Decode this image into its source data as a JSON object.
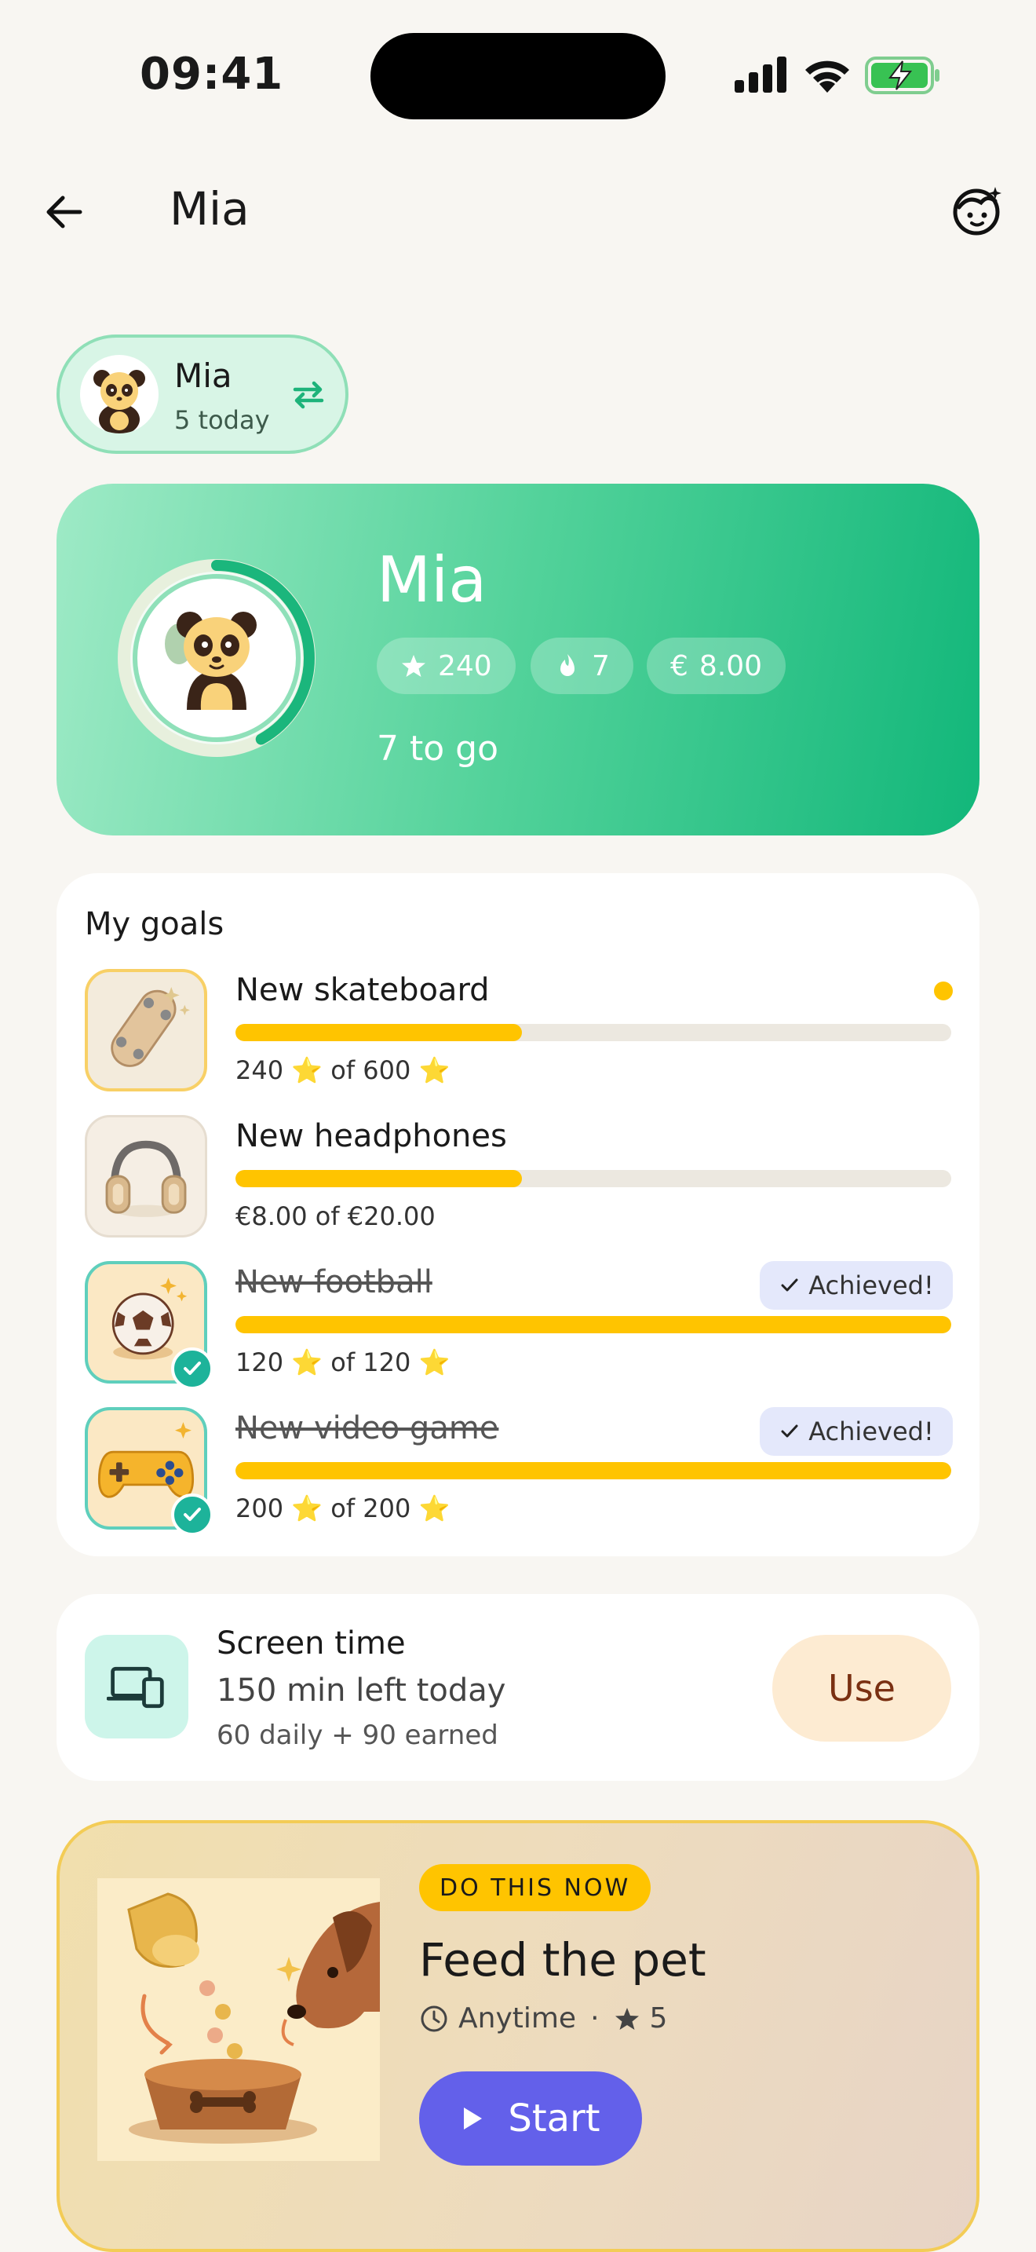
{
  "status_bar": {
    "time": "09:41"
  },
  "header": {
    "title": "Mia"
  },
  "profile_chip": {
    "name": "Mia",
    "subtitle": "5 today"
  },
  "hero": {
    "name": "Mia",
    "stars": "240",
    "streak": "7",
    "money": "8.00",
    "to_go": "7 to go",
    "ring_progress": 0.42,
    "colors": {
      "start": "#9eeac6",
      "end": "#12b77a"
    }
  },
  "goals": {
    "title": "My goals",
    "items": [
      {
        "name": "New skateboard",
        "progress": 0.4,
        "achieved": false,
        "current": "240",
        "of": "of 600",
        "unit": "star",
        "thumb": "skateboard-icon"
      },
      {
        "name": "New headphones",
        "progress": 0.4,
        "achieved": false,
        "text": "€8.00 of €20.00",
        "thumb": "headphones-icon"
      },
      {
        "name": "New football",
        "progress": 1.0,
        "achieved": true,
        "badge": "Achieved!",
        "current": "120",
        "of": "of 120",
        "unit": "star",
        "thumb": "football-icon"
      },
      {
        "name": "New video game",
        "progress": 1.0,
        "achieved": true,
        "badge": "Achieved!",
        "current": "200",
        "of": "of 200",
        "unit": "star",
        "thumb": "gamepad-icon"
      }
    ]
  },
  "screen_time": {
    "title": "Screen time",
    "left": "150 min left today",
    "detail": "60 daily + 90 earned",
    "button": "Use"
  },
  "task": {
    "tag": "DO THIS NOW",
    "title": "Feed the pet",
    "when": "Anytime",
    "separator": "·",
    "points": "5",
    "button": "Start"
  },
  "colors": {
    "accent_yellow": "#ffc400",
    "accent_green": "#1db39a",
    "primary_button": "#6360ea"
  }
}
